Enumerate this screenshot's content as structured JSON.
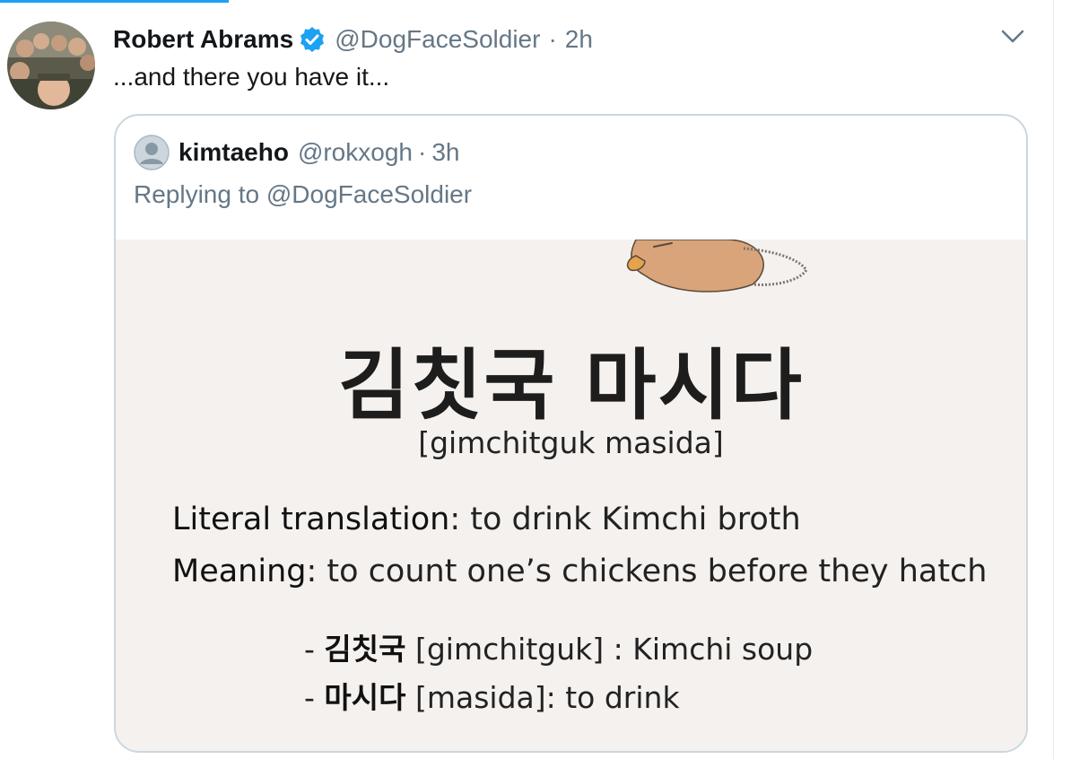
{
  "tweet": {
    "author_name": "Robert Abrams",
    "handle": "@DogFaceSoldier",
    "separator": "·",
    "time": "2h",
    "text": "...and there you have it..."
  },
  "quoted_tweet": {
    "author_name": "kimtaeho",
    "handle": "@rokxogh",
    "separator": "·",
    "time": "3h",
    "replying_prefix": "Replying to ",
    "replying_to": "@DogFaceSoldier",
    "card": {
      "korean_phrase": "김칫국 마시다",
      "romanization": "[gimchitguk masida]",
      "literal_label": "Literal translation",
      "literal_value": ": to drink Kimchi broth",
      "meaning_label": "Meaning",
      "meaning_value": ": to count one’s chickens before they hatch",
      "vocab": [
        {
          "dash": "- ",
          "korean": "김칫국",
          "rest": " [gimchitguk] : Kimchi soup"
        },
        {
          "dash": "- ",
          "korean": "마시다",
          "rest": " [masida]: to drink"
        }
      ]
    }
  },
  "colors": {
    "accent": "#1da1f2",
    "text_primary": "#14171a",
    "text_secondary": "#657786",
    "border": "#ccd6dd",
    "card_background": "#f5f1ee"
  },
  "icons": {
    "verified": "verified-badge-icon",
    "caret": "chevron-down-icon",
    "default_avatar": "default-profile-icon"
  }
}
